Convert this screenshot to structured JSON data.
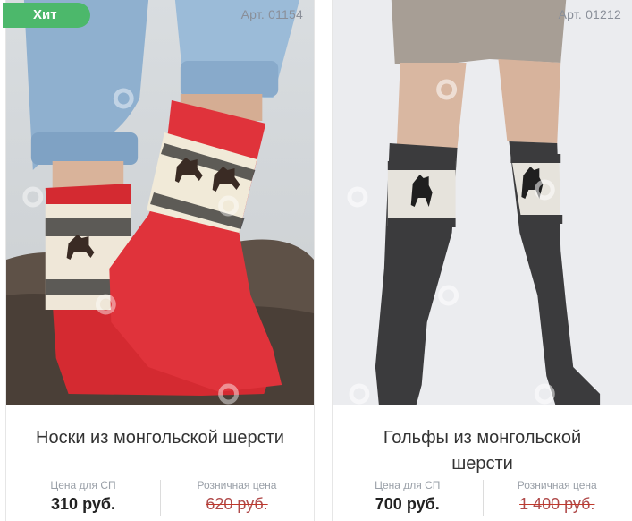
{
  "products": [
    {
      "badge": "Хит",
      "article": "Арт. 01154",
      "title": "Носки из монгольской шерсти",
      "sp_label": "Цена для СП",
      "sp_price": "310 руб.",
      "retail_label": "Розничная цена",
      "retail_price": "620 руб."
    },
    {
      "article": "Арт. 01212",
      "title": "Гольфы из монгольской шерсти",
      "sp_label": "Цена для СП",
      "sp_price": "700 руб.",
      "retail_label": "Розничная цена",
      "retail_price": "1 400 руб."
    }
  ],
  "colors": {
    "badge": "#4cb86b",
    "retail_strike": "#c0392b"
  }
}
